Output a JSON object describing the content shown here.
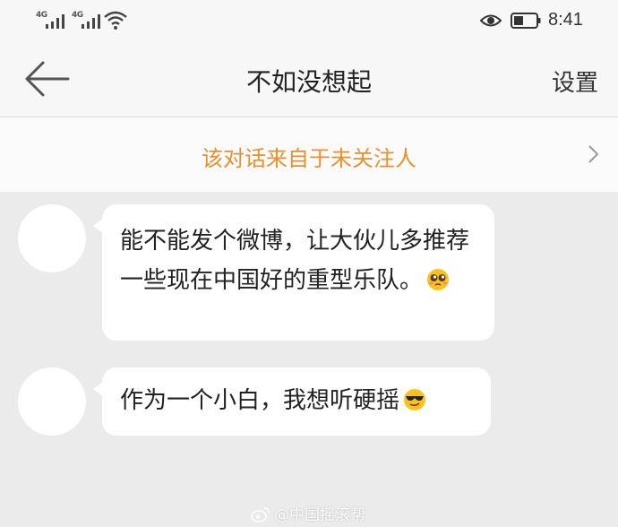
{
  "status_bar": {
    "sim1": "4G",
    "sim2": "4G",
    "time": "8:41",
    "icons": [
      "signal-icon",
      "signal-icon",
      "wifi-icon",
      "eye-icon",
      "battery-icon"
    ]
  },
  "nav": {
    "back_icon": "back-arrow-icon",
    "title": "不如没想起",
    "settings_label": "设置"
  },
  "notice": {
    "text": "该对话来自于未关注人",
    "icon": "chevron-right-icon",
    "color": "#e8902d"
  },
  "messages": [
    {
      "text": "能不能发个微博，让大伙儿多推荐一些现在中国好的重型乐队。",
      "emoji": "pleading-face-icon"
    },
    {
      "text": "作为一个小白，我想听硬摇",
      "emoji": "sunglasses-face-icon"
    }
  ],
  "watermark": {
    "text": "@中国摇滚帮",
    "icon": "weibo-icon"
  }
}
